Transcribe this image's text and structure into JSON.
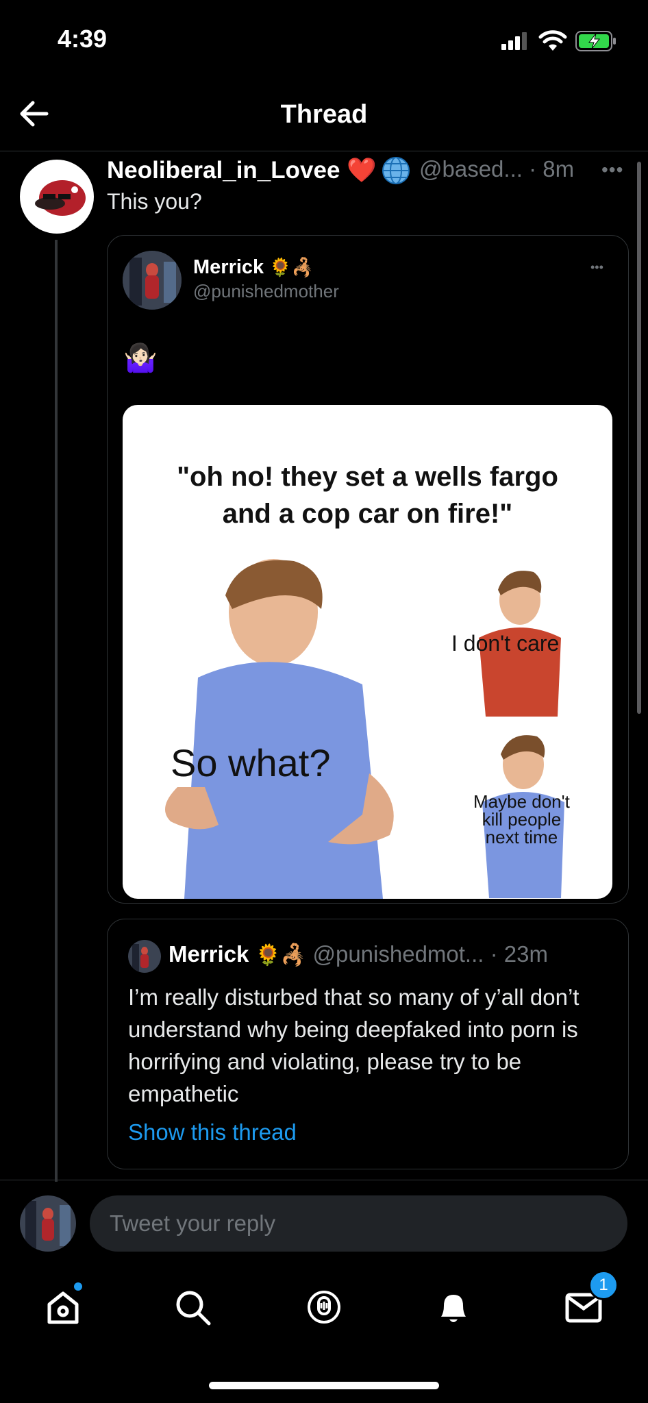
{
  "status_bar": {
    "time": "4:39"
  },
  "nav": {
    "title": "Thread"
  },
  "tweet": {
    "author_name": "Neoliberal_in_Lovee",
    "author_emoji": "❤️",
    "handle": "@based...",
    "time": "· 8m",
    "text": "This you?"
  },
  "quoted_tweet": {
    "name": "Merrick",
    "handle": "@punishedmother",
    "name_emoji": "🌻🦂",
    "body_emoji": "🤷🏻‍♀️",
    "meme": {
      "caption_line1": "\"oh no! they set a wells fargo",
      "caption_line2": "and a cop car on fire!\"",
      "label_main": "So what?",
      "label_top_right": "I don't care",
      "label_bottom_right_1": "Maybe don't",
      "label_bottom_right_2": "kill people",
      "label_bottom_right_3": "next time"
    }
  },
  "quoted_tweet_2": {
    "name": "Merrick",
    "name_emoji": "🌻🦂",
    "handle": "@punishedmot...",
    "time": "· 23m",
    "text": "I’m really disturbed that so many of y’all don’t understand why being deepfaked into porn is horrifying and violating, please try to be empathetic",
    "show_thread": "Show this thread"
  },
  "reply": {
    "placeholder": "Tweet your reply"
  },
  "tabbar": {
    "home": "home-icon",
    "search": "search-icon",
    "spaces": "spaces-icon",
    "notifications": "bell-icon",
    "messages": "mail-icon",
    "messages_badge": "1"
  },
  "colors": {
    "accent": "#1d9bf0",
    "background": "#000000",
    "secondary_text": "#71767b"
  }
}
